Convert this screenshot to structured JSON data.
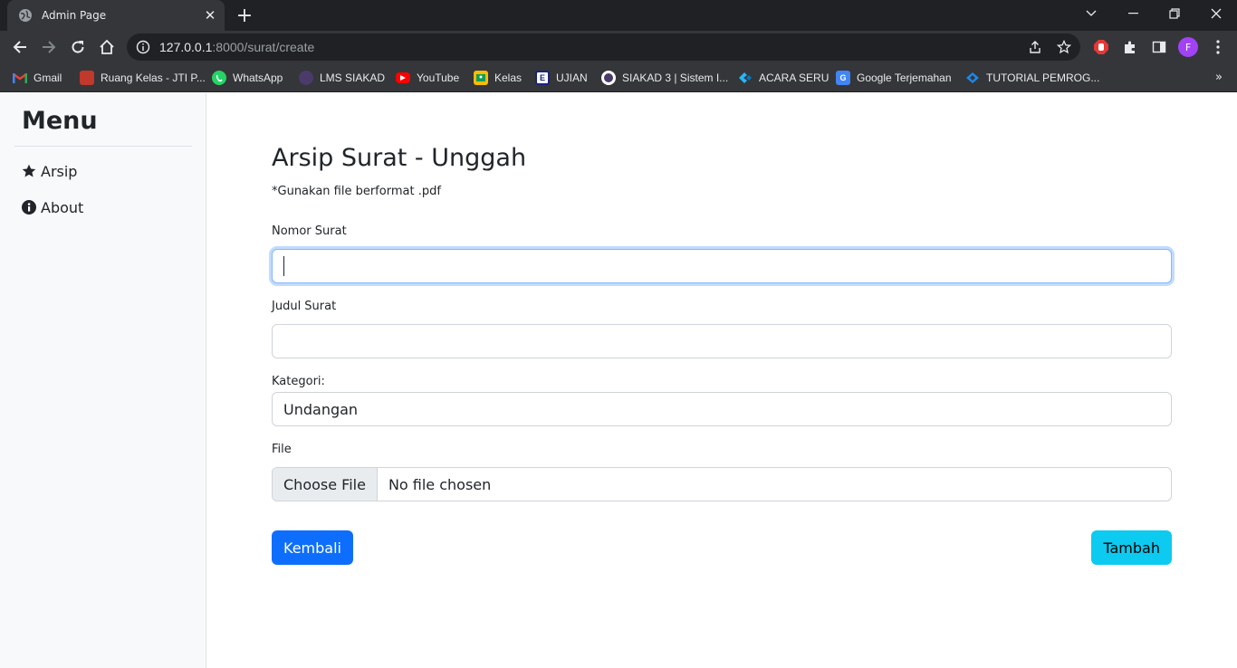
{
  "browser": {
    "tab_title": "Admin Page",
    "url_host": "127.0.0.1",
    "url_rest": ":8000/surat/create",
    "profile_initial": "F",
    "bookmarks": [
      {
        "label": "Gmail",
        "icon": "gmail-icon",
        "color": "#ea4335"
      },
      {
        "label": "Ruang Kelas - JTI P...",
        "icon": "ruang-kelas-icon",
        "color": "#c0392b"
      },
      {
        "label": "WhatsApp",
        "icon": "whatsapp-icon",
        "color": "#25d366"
      },
      {
        "label": "LMS SIAKAD",
        "icon": "lms-icon",
        "color": "#8e44ad"
      },
      {
        "label": "YouTube",
        "icon": "youtube-icon",
        "color": "#ff0000"
      },
      {
        "label": "Kelas",
        "icon": "kelas-icon",
        "color": "#fbbc04"
      },
      {
        "label": "UJIAN",
        "icon": "ujian-icon",
        "color": "#1a237e"
      },
      {
        "label": "SIAKAD 3 | Sistem I...",
        "icon": "siakad-icon",
        "color": "#7b5ea7"
      },
      {
        "label": "ACARA SERU",
        "icon": "acara-icon",
        "color": "#1da1f2"
      },
      {
        "label": "Google Terjemahan",
        "icon": "translate-icon",
        "color": "#4285f4"
      },
      {
        "label": "TUTORIAL PEMROG...",
        "icon": "tutorial-icon",
        "color": "#1e88e5"
      }
    ]
  },
  "sidebar": {
    "title": "Menu",
    "items": [
      {
        "label": "Arsip",
        "icon": "star-icon"
      },
      {
        "label": "About",
        "icon": "info-icon"
      }
    ]
  },
  "form": {
    "heading": "Arsip Surat - Unggah",
    "note": "*Gunakan file berformat .pdf",
    "nomor_label": "Nomor Surat",
    "nomor_value": "",
    "judul_label": "Judul Surat",
    "judul_value": "",
    "kategori_label": "Kategori:",
    "kategori_value": "Undangan",
    "file_label": "File",
    "file_button": "Choose File",
    "file_status": "No file chosen",
    "back_button": "Kembali",
    "submit_button": "Tambah"
  },
  "colors": {
    "primary": "#0d6efd",
    "info": "#0dcaf0",
    "focus_border": "#86b7fe",
    "profile": "#a142f4"
  }
}
